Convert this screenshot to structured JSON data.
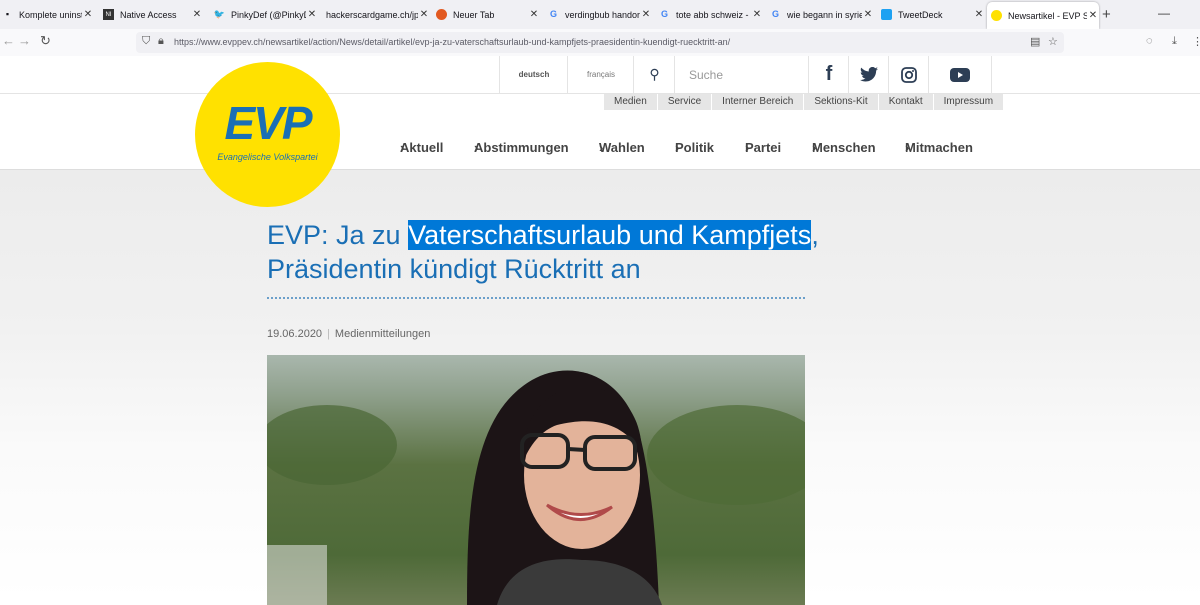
{
  "browser": {
    "tabs": [
      {
        "title": "Komplete uninstall a",
        "icon": "app-icon"
      },
      {
        "title": "Native Access",
        "icon": "app-icon"
      },
      {
        "title": "PinkyDef (@PinkyDef",
        "icon": "twitter-icon"
      },
      {
        "title": "hackerscardgame.ch/jpg",
        "icon": "blank-icon"
      },
      {
        "title": "Neuer Tab",
        "icon": "firefox-icon"
      },
      {
        "title": "verdingbub handorg",
        "icon": "google-icon"
      },
      {
        "title": "tote abb schweiz - Go",
        "icon": "google-icon"
      },
      {
        "title": "wie begann in syrien",
        "icon": "google-icon"
      },
      {
        "title": "TweetDeck",
        "icon": "tweetdeck-icon"
      },
      {
        "title": "Newsartikel - EVP Sch",
        "icon": "evp-icon",
        "active": true
      }
    ],
    "url": "https://www.evppev.ch/newsartikel/action/News/detail/artikel/evp-ja-zu-vaterschaftsurlaub-und-kampfjets-praesidentin-kuendigt-ruecktritt-an/"
  },
  "site": {
    "lang": {
      "de": "deutsch",
      "fr": "français"
    },
    "search_placeholder": "Suche",
    "social": [
      "facebook-icon",
      "twitter-icon",
      "instagram-icon",
      "youtube-icon"
    ],
    "utility_nav": [
      "Medien",
      "Service",
      "Interner Bereich",
      "Sektions-Kit",
      "Kontakt",
      "Impressum"
    ],
    "logo": {
      "text": "EVP",
      "subtitle": "Evangelische Volkspartei"
    },
    "main_nav": [
      "Aktuell",
      "Abstimmungen",
      "Wahlen",
      "Politik",
      "Partei",
      "Menschen",
      "Mitmachen"
    ],
    "colors": {
      "brand_blue": "#1a6fb5",
      "logo_yellow": "#ffe100",
      "selection": "#0078d7"
    }
  },
  "article": {
    "title_part1": "EVP: Ja zu ",
    "title_selected": "Vaterschaftsurlaub und Kampfjets",
    "title_part2": ",",
    "title_line2": "Präsidentin kündigt Rücktritt an",
    "date": "19.06.2020",
    "category": "Medienmitteilungen"
  }
}
